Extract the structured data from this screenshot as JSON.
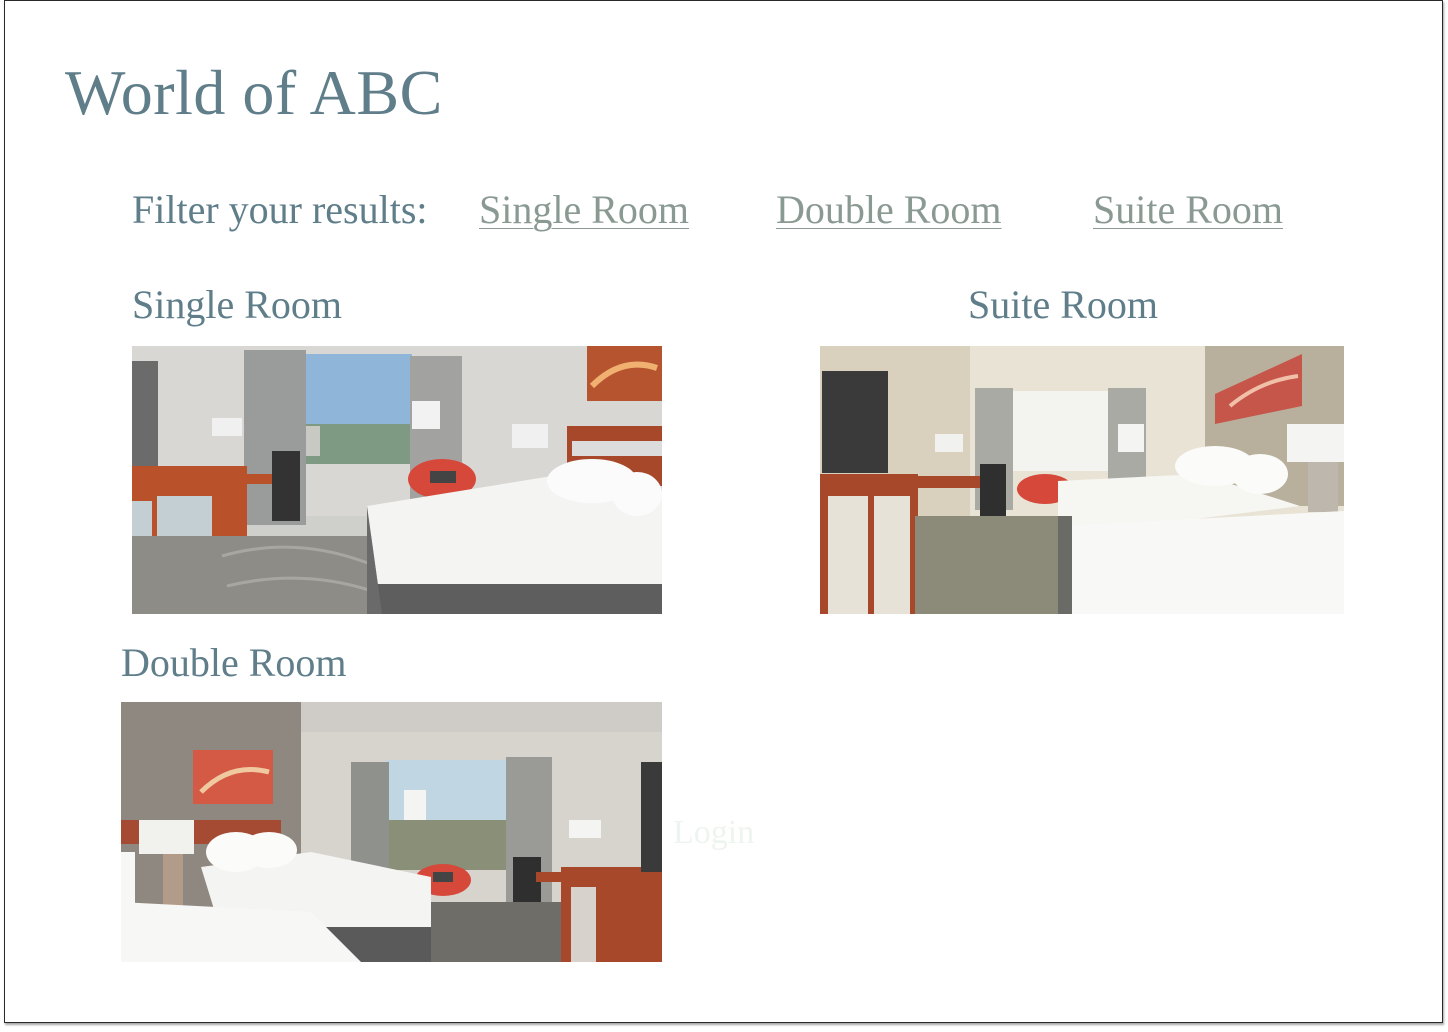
{
  "site": {
    "title": "World of ABC"
  },
  "filter": {
    "label": "Filter your results:",
    "options": [
      {
        "label": "Single Room"
      },
      {
        "label": "Double Room"
      },
      {
        "label": "Suite Room"
      }
    ]
  },
  "rooms": [
    {
      "title": "Single Room",
      "photo": "single-room-photo"
    },
    {
      "title": "Suite Room",
      "photo": "suite-room-photo"
    },
    {
      "title": "Double Room",
      "photo": "double-room-photo"
    }
  ],
  "ghost_link": {
    "label": "Login"
  },
  "colors": {
    "heading": "#5f7e8a",
    "link": "#8a9a93",
    "accent_chair": "#d6483a",
    "bed_linen": "#f4f4f2",
    "wood": "#b9512b"
  }
}
